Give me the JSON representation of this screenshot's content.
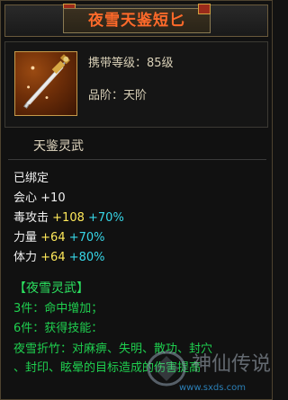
{
  "title": "夜雪天鉴短匕",
  "item": {
    "level_line": "携带等级：85级",
    "grade_line": "品阶：天阶",
    "linggu": "天鉴灵武"
  },
  "status": "已绑定",
  "stats": [
    {
      "name": "会心",
      "base": "+10",
      "plus": ""
    },
    {
      "name": "毒攻击",
      "base": "+108",
      "plus": "+70%"
    },
    {
      "name": "力量",
      "base": "+64",
      "plus": "+70%"
    },
    {
      "name": "体力",
      "base": "+64",
      "plus": "+80%"
    }
  ],
  "set": {
    "title": "【夜雪灵武】",
    "l3": "3件：命中增加；",
    "l6": "6件：获得技能：",
    "desc1": "夜雪折竹：对麻痹、失明、散功、封穴",
    "desc2": "、封印、眩晕的目标造成的伤害提高"
  },
  "watermark": {
    "brand": "神仙传说",
    "url": "www.sxds.com"
  },
  "colors": {
    "title": "#ff6a2a",
    "set_green": "#1fd04f",
    "base_yellow": "#ffe95a",
    "plus_cyan": "#37d7e8"
  }
}
